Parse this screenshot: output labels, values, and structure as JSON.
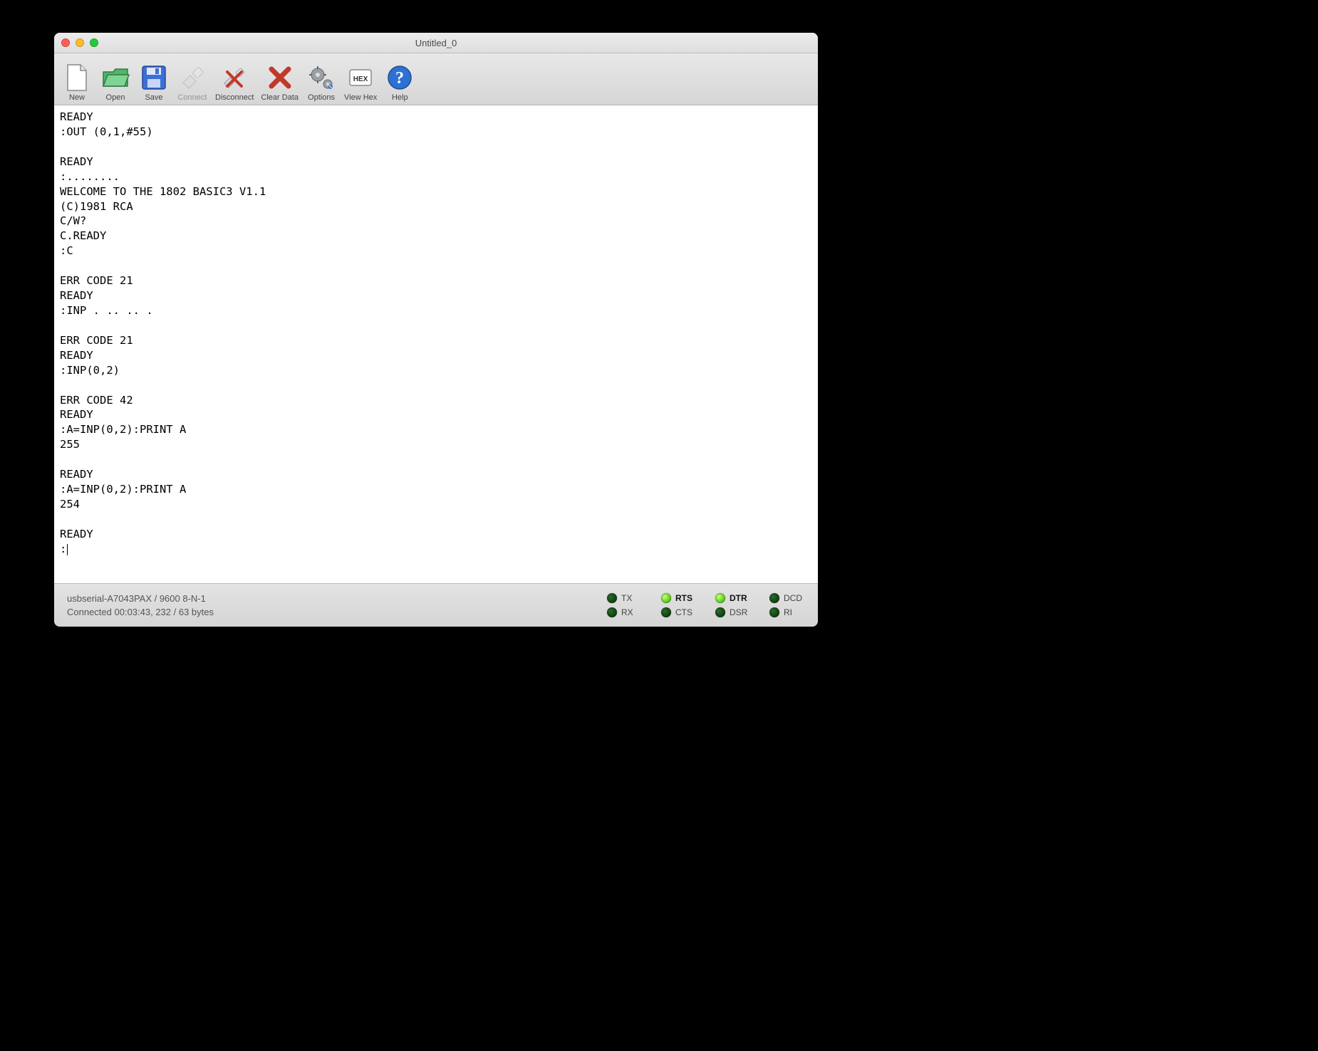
{
  "window": {
    "title": "Untitled_0"
  },
  "toolbar": {
    "new": "New",
    "open": "Open",
    "save": "Save",
    "connect": "Connect",
    "disconnect": "Disconnect",
    "clear": "Clear Data",
    "options": "Options",
    "viewhex": "View Hex",
    "help": "Help"
  },
  "terminal": {
    "content": "READY\n:OUT (0,1,#55)\n\nREADY\n:........\nWELCOME TO THE 1802 BASIC3 V1.1\n(C)1981 RCA\nC/W?\nC.READY\n:C\n\nERR CODE 21\nREADY\n:INP . .. .. .\n\nERR CODE 21\nREADY\n:INP(0,2)\n\nERR CODE 42\nREADY\n:A=INP(0,2):PRINT A\n255\n\nREADY\n:A=INP(0,2):PRINT A\n254\n\nREADY\n:"
  },
  "status": {
    "port": "usbserial-A7043PAX / 9600 8-N-1",
    "conn": "Connected 00:03:43, 232 / 63 bytes",
    "leds": {
      "tx": {
        "label": "TX",
        "on": false,
        "bold": false
      },
      "rx": {
        "label": "RX",
        "on": false,
        "bold": false
      },
      "rts": {
        "label": "RTS",
        "on": true,
        "bold": true
      },
      "cts": {
        "label": "CTS",
        "on": false,
        "bold": false
      },
      "dtr": {
        "label": "DTR",
        "on": true,
        "bold": true
      },
      "dsr": {
        "label": "DSR",
        "on": false,
        "bold": false
      },
      "dcd": {
        "label": "DCD",
        "on": false,
        "bold": false
      },
      "ri": {
        "label": "RI",
        "on": false,
        "bold": false
      }
    }
  }
}
